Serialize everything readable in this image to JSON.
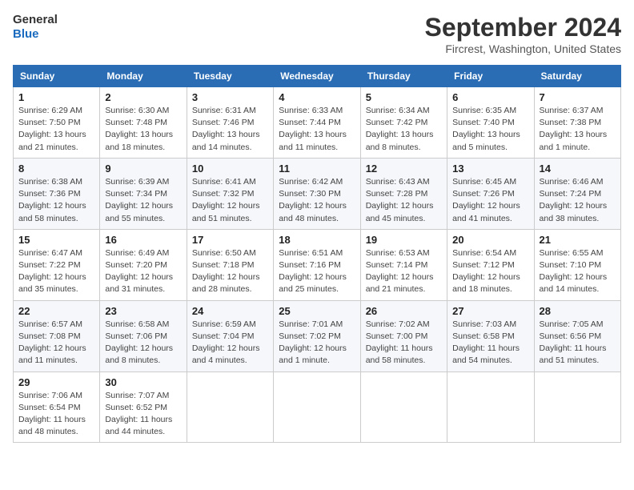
{
  "header": {
    "logo_line1": "General",
    "logo_line2": "Blue",
    "month": "September 2024",
    "location": "Fircrest, Washington, United States"
  },
  "days_of_week": [
    "Sunday",
    "Monday",
    "Tuesday",
    "Wednesday",
    "Thursday",
    "Friday",
    "Saturday"
  ],
  "weeks": [
    [
      {
        "day": "1",
        "info": "Sunrise: 6:29 AM\nSunset: 7:50 PM\nDaylight: 13 hours\nand 21 minutes."
      },
      {
        "day": "2",
        "info": "Sunrise: 6:30 AM\nSunset: 7:48 PM\nDaylight: 13 hours\nand 18 minutes."
      },
      {
        "day": "3",
        "info": "Sunrise: 6:31 AM\nSunset: 7:46 PM\nDaylight: 13 hours\nand 14 minutes."
      },
      {
        "day": "4",
        "info": "Sunrise: 6:33 AM\nSunset: 7:44 PM\nDaylight: 13 hours\nand 11 minutes."
      },
      {
        "day": "5",
        "info": "Sunrise: 6:34 AM\nSunset: 7:42 PM\nDaylight: 13 hours\nand 8 minutes."
      },
      {
        "day": "6",
        "info": "Sunrise: 6:35 AM\nSunset: 7:40 PM\nDaylight: 13 hours\nand 5 minutes."
      },
      {
        "day": "7",
        "info": "Sunrise: 6:37 AM\nSunset: 7:38 PM\nDaylight: 13 hours\nand 1 minute."
      }
    ],
    [
      {
        "day": "8",
        "info": "Sunrise: 6:38 AM\nSunset: 7:36 PM\nDaylight: 12 hours\nand 58 minutes."
      },
      {
        "day": "9",
        "info": "Sunrise: 6:39 AM\nSunset: 7:34 PM\nDaylight: 12 hours\nand 55 minutes."
      },
      {
        "day": "10",
        "info": "Sunrise: 6:41 AM\nSunset: 7:32 PM\nDaylight: 12 hours\nand 51 minutes."
      },
      {
        "day": "11",
        "info": "Sunrise: 6:42 AM\nSunset: 7:30 PM\nDaylight: 12 hours\nand 48 minutes."
      },
      {
        "day": "12",
        "info": "Sunrise: 6:43 AM\nSunset: 7:28 PM\nDaylight: 12 hours\nand 45 minutes."
      },
      {
        "day": "13",
        "info": "Sunrise: 6:45 AM\nSunset: 7:26 PM\nDaylight: 12 hours\nand 41 minutes."
      },
      {
        "day": "14",
        "info": "Sunrise: 6:46 AM\nSunset: 7:24 PM\nDaylight: 12 hours\nand 38 minutes."
      }
    ],
    [
      {
        "day": "15",
        "info": "Sunrise: 6:47 AM\nSunset: 7:22 PM\nDaylight: 12 hours\nand 35 minutes."
      },
      {
        "day": "16",
        "info": "Sunrise: 6:49 AM\nSunset: 7:20 PM\nDaylight: 12 hours\nand 31 minutes."
      },
      {
        "day": "17",
        "info": "Sunrise: 6:50 AM\nSunset: 7:18 PM\nDaylight: 12 hours\nand 28 minutes."
      },
      {
        "day": "18",
        "info": "Sunrise: 6:51 AM\nSunset: 7:16 PM\nDaylight: 12 hours\nand 25 minutes."
      },
      {
        "day": "19",
        "info": "Sunrise: 6:53 AM\nSunset: 7:14 PM\nDaylight: 12 hours\nand 21 minutes."
      },
      {
        "day": "20",
        "info": "Sunrise: 6:54 AM\nSunset: 7:12 PM\nDaylight: 12 hours\nand 18 minutes."
      },
      {
        "day": "21",
        "info": "Sunrise: 6:55 AM\nSunset: 7:10 PM\nDaylight: 12 hours\nand 14 minutes."
      }
    ],
    [
      {
        "day": "22",
        "info": "Sunrise: 6:57 AM\nSunset: 7:08 PM\nDaylight: 12 hours\nand 11 minutes."
      },
      {
        "day": "23",
        "info": "Sunrise: 6:58 AM\nSunset: 7:06 PM\nDaylight: 12 hours\nand 8 minutes."
      },
      {
        "day": "24",
        "info": "Sunrise: 6:59 AM\nSunset: 7:04 PM\nDaylight: 12 hours\nand 4 minutes."
      },
      {
        "day": "25",
        "info": "Sunrise: 7:01 AM\nSunset: 7:02 PM\nDaylight: 12 hours\nand 1 minute."
      },
      {
        "day": "26",
        "info": "Sunrise: 7:02 AM\nSunset: 7:00 PM\nDaylight: 11 hours\nand 58 minutes."
      },
      {
        "day": "27",
        "info": "Sunrise: 7:03 AM\nSunset: 6:58 PM\nDaylight: 11 hours\nand 54 minutes."
      },
      {
        "day": "28",
        "info": "Sunrise: 7:05 AM\nSunset: 6:56 PM\nDaylight: 11 hours\nand 51 minutes."
      }
    ],
    [
      {
        "day": "29",
        "info": "Sunrise: 7:06 AM\nSunset: 6:54 PM\nDaylight: 11 hours\nand 48 minutes."
      },
      {
        "day": "30",
        "info": "Sunrise: 7:07 AM\nSunset: 6:52 PM\nDaylight: 11 hours\nand 44 minutes."
      },
      {
        "day": "",
        "info": ""
      },
      {
        "day": "",
        "info": ""
      },
      {
        "day": "",
        "info": ""
      },
      {
        "day": "",
        "info": ""
      },
      {
        "day": "",
        "info": ""
      }
    ]
  ]
}
